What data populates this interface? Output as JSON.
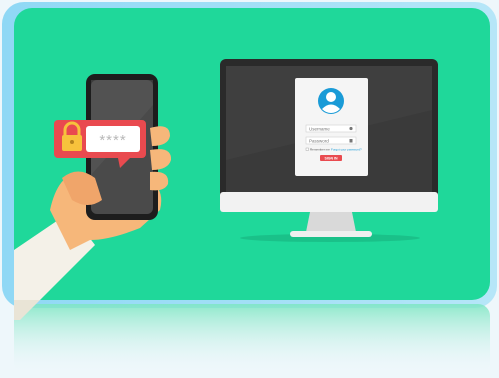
{
  "scene": {
    "background_color": "#1fd89a",
    "frame_color": "#3ab8ea",
    "phone": {
      "pin_mask": "****",
      "lock_icon": "padlock-icon",
      "bubble_color": "#e94a4f"
    },
    "monitor": {
      "login_card": {
        "avatar_icon": "user-avatar-icon",
        "username_placeholder": "Username",
        "password_placeholder": "Password",
        "remember_me_label": "Remember me",
        "forgot_password_label": "Forgot your password?",
        "sign_in_button_label": "SIGN IN",
        "accent_color": "#e94a4f"
      }
    }
  }
}
